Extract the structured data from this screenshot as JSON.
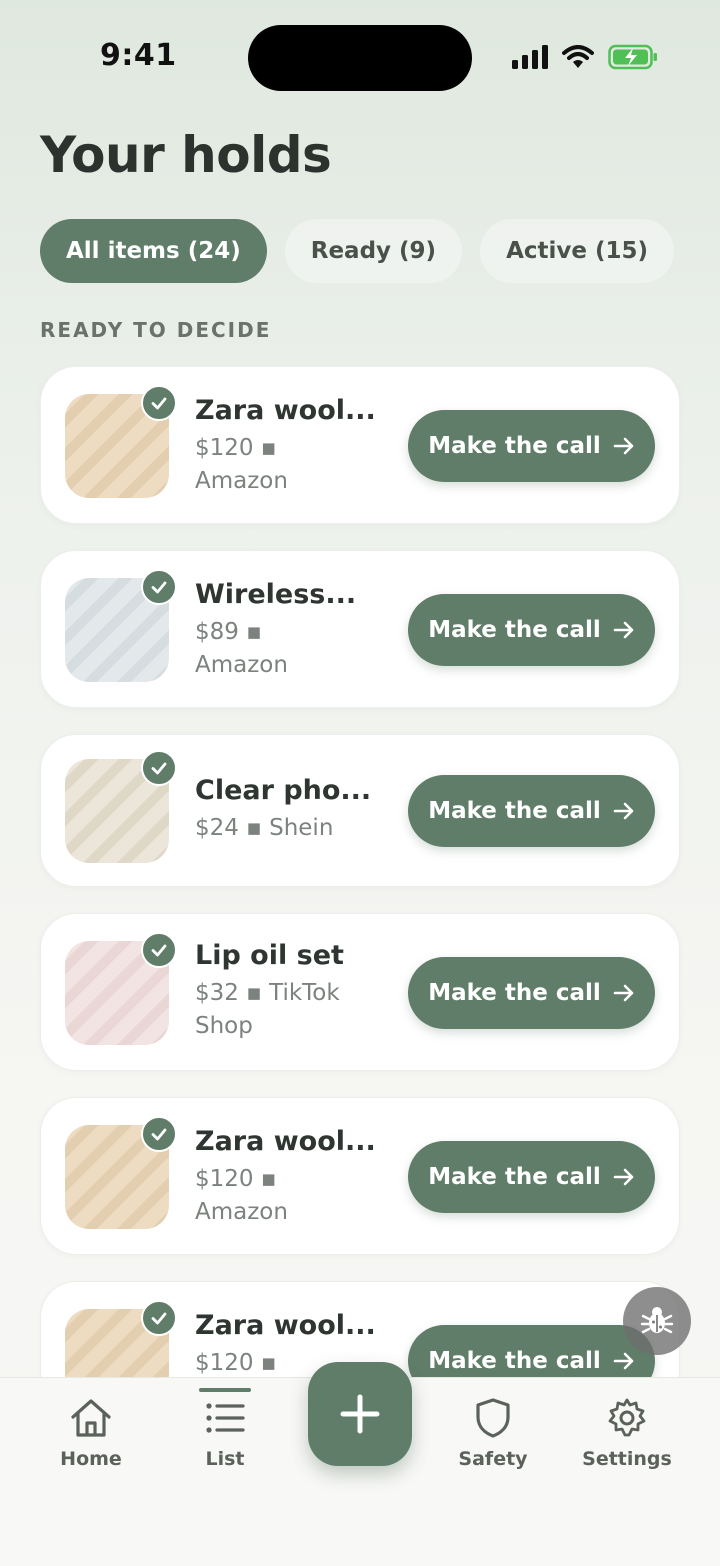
{
  "status_bar": {
    "time": "9:41"
  },
  "page": {
    "title": "Your holds"
  },
  "tabs": [
    {
      "label": "All items (24)",
      "active": true
    },
    {
      "label": "Ready (9)",
      "active": false
    },
    {
      "label": "Active (15)",
      "active": false
    }
  ],
  "section": {
    "label": "READY TO DECIDE"
  },
  "items": [
    {
      "name": "Zara wool...",
      "meta_line1": "$120 ▪",
      "meta_line2": "Amazon",
      "cta": "Make the call",
      "thumb_color": "#ecdcc2"
    },
    {
      "name": "Wireless...",
      "meta_line1": "$89 ▪",
      "meta_line2": "Amazon",
      "cta": "Make the call",
      "thumb_color": "#e0e5e8"
    },
    {
      "name": "Clear pho...",
      "meta_line1": "$24 ▪ Shein",
      "meta_line2": "",
      "cta": "Make the call",
      "thumb_color": "#e9e3d7"
    },
    {
      "name": "Lip oil set",
      "meta_line1": "$32 ▪ TikTok",
      "meta_line2": "Shop",
      "cta": "Make the call",
      "thumb_color": "#f0e2e1"
    },
    {
      "name": "Zara wool...",
      "meta_line1": "$120 ▪",
      "meta_line2": "Amazon",
      "cta": "Make the call",
      "thumb_color": "#ecdcc2"
    },
    {
      "name": "Zara wool...",
      "meta_line1": "$120 ▪",
      "meta_line2": "",
      "cta": "Make the call",
      "thumb_color": "#ecdcc2"
    }
  ],
  "nav": {
    "home": "Home",
    "list": "List",
    "safety": "Safety",
    "settings": "Settings",
    "active": "list"
  },
  "colors": {
    "accent": "#5f7d69",
    "background_top": "#dfe8df",
    "background_bottom": "#f7f7f5"
  },
  "icons": {
    "status": [
      "signal-icon",
      "wifi-icon",
      "battery-charging-icon"
    ],
    "debug": "bug-icon",
    "fab": "plus-icon"
  }
}
